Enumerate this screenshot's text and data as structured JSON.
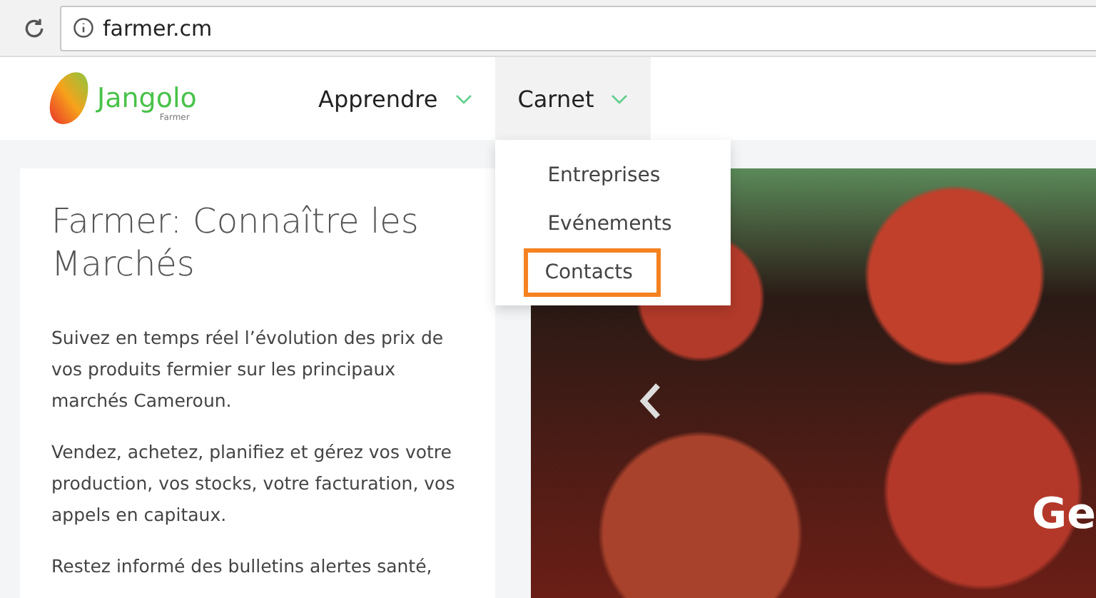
{
  "browser": {
    "url": "farmer.cm"
  },
  "logo": {
    "name": "Jangolo",
    "tagline": "Farmer"
  },
  "nav": [
    {
      "label": "Apprendre",
      "expanded": false
    },
    {
      "label": "Carnet",
      "expanded": true,
      "menu": [
        {
          "label": "Entreprises",
          "highlighted": false
        },
        {
          "label": "Evénements",
          "highlighted": false
        },
        {
          "label": "Contacts",
          "highlighted": true
        }
      ]
    }
  ],
  "intro": {
    "title": "Farmer: Connaître les Marchés",
    "paragraphs": [
      "Suivez en temps réel l’évolution des prix de vos produits fermier sur les principaux marchés Cameroun.",
      "Vendez, achetez, planifiez et gérez vos votre production, vos stocks, votre facturation, vos appels en capitaux.",
      "Restez informé des bulletins alertes santé,"
    ]
  },
  "carousel": {
    "caption": "Ge"
  }
}
